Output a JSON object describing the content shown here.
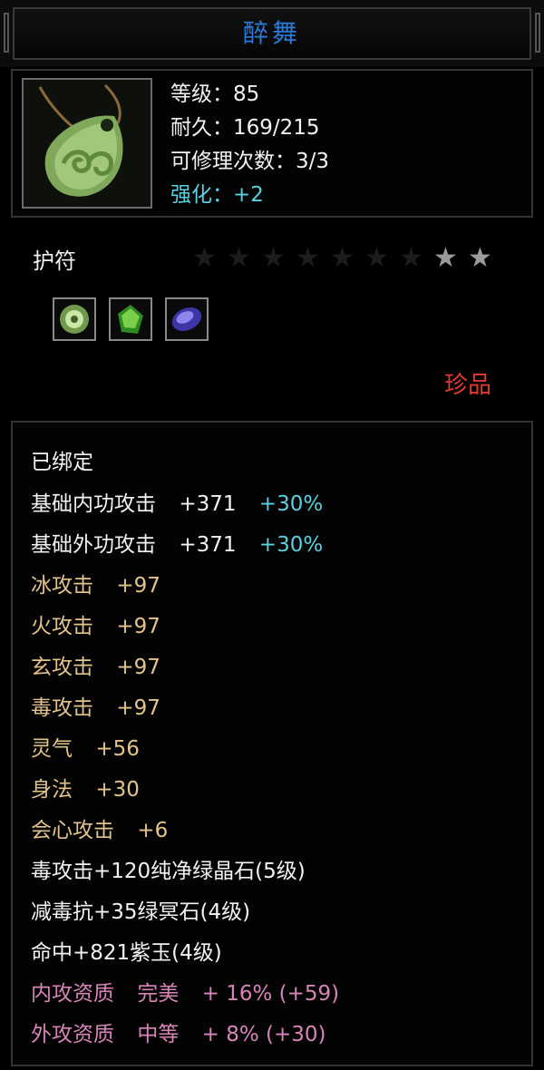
{
  "item": {
    "name": "醉舞",
    "level": "等级：85",
    "durability": "耐久：169/215",
    "repairs": "可修理次数：3/3",
    "enhance": "强化：+2",
    "type": "护符",
    "stars_total": 9,
    "stars_lit": 2,
    "rarity": "珍品",
    "icon": "jade-pendant-icon"
  },
  "gems": [
    "jade-disc-gem-icon",
    "green-crystal-gem-icon",
    "purple-jade-gem-icon"
  ],
  "attributes": {
    "bound": "已绑定",
    "base_inner": {
      "label": "基础内功攻击",
      "value": "+371",
      "bonus": "+30%"
    },
    "base_outer": {
      "label": "基础外功攻击",
      "value": "+371",
      "bonus": "+30%"
    },
    "ice": {
      "label": "冰攻击",
      "value": "+97"
    },
    "fire": {
      "label": "火攻击",
      "value": "+97"
    },
    "xuan": {
      "label": "玄攻击",
      "value": "+97"
    },
    "poison": {
      "label": "毒攻击",
      "value": "+97"
    },
    "spirit": {
      "label": "灵气",
      "value": "+56"
    },
    "agility": {
      "label": "身法",
      "value": "+30"
    },
    "crit": {
      "label": "会心攻击",
      "value": "+6"
    },
    "socket1": "毒攻击+120纯净绿晶石(5级)",
    "socket2": "减毒抗+35绿冥石(4级)",
    "socket3": "命中+821紫玉(4级)",
    "quality_inner": {
      "label": "内攻资质",
      "grade": "完美",
      "value": "+ 16% (+59)"
    },
    "quality_outer": {
      "label": "外攻资质",
      "grade": "中等",
      "value": "+ 8% (+30)"
    }
  },
  "colors": {
    "title": "#2b7ad8",
    "cyan": "#5bd0e0",
    "gold": "#e2c48a",
    "pink": "#d884b8",
    "rarity": "#e23a2a"
  }
}
